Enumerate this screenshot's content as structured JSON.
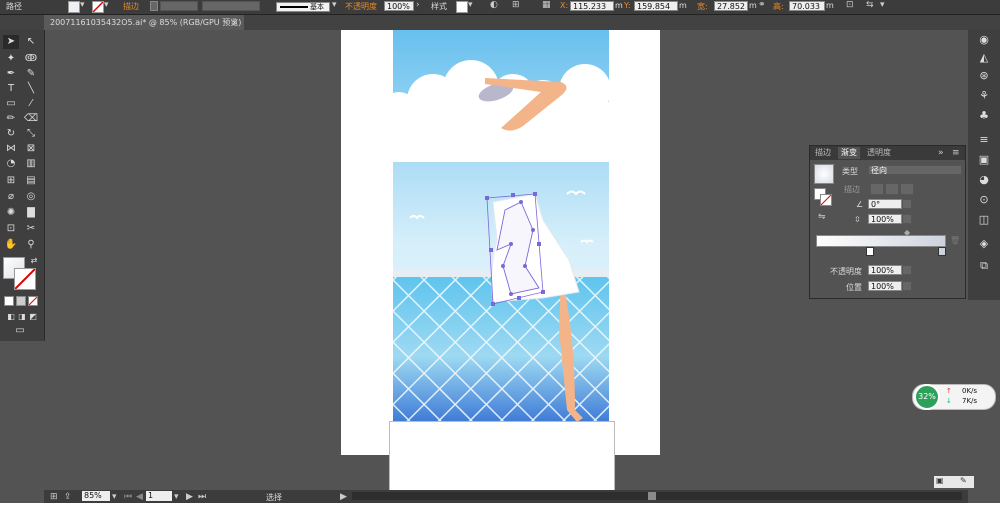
{
  "control_bar": {
    "object_type": "路径",
    "stroke_label": "描边",
    "stroke_style": "基本",
    "opacity_label": "不透明度",
    "opacity_value": "100%",
    "style_label": "样式",
    "x_label": "X:",
    "x_value": "115.233",
    "y_label": "Y:",
    "y_value": "159.854",
    "w_label": "宽:",
    "w_value": "27.852",
    "h_label": "高:",
    "h_value": "70.033",
    "unit": "m"
  },
  "document_tab": {
    "label": "20071161035432O5.ai* @ 85% (RGB/GPU 预览)",
    "close": "×"
  },
  "gradient_panel": {
    "tabs": [
      "描边",
      "渐变",
      "透明度"
    ],
    "type_label": "类型",
    "type_value": "径向",
    "stroke_label": "描边",
    "angle_value": "0°",
    "aspect_value": "100%",
    "opacity_label": "不透明度",
    "opacity_value": "100%",
    "position_label": "位置",
    "position_value": "100%"
  },
  "status_bar": {
    "zoom": "85%",
    "page": "1",
    "tool": "选择"
  },
  "net_widget": {
    "percent": "32%",
    "up": "0K/s",
    "down": "7K/s"
  },
  "colors": {
    "accent": "#e58a2c",
    "sky_top": "#68c0ee",
    "sky_bottom": "#e9f6fc",
    "selection": "#7b68d8"
  }
}
